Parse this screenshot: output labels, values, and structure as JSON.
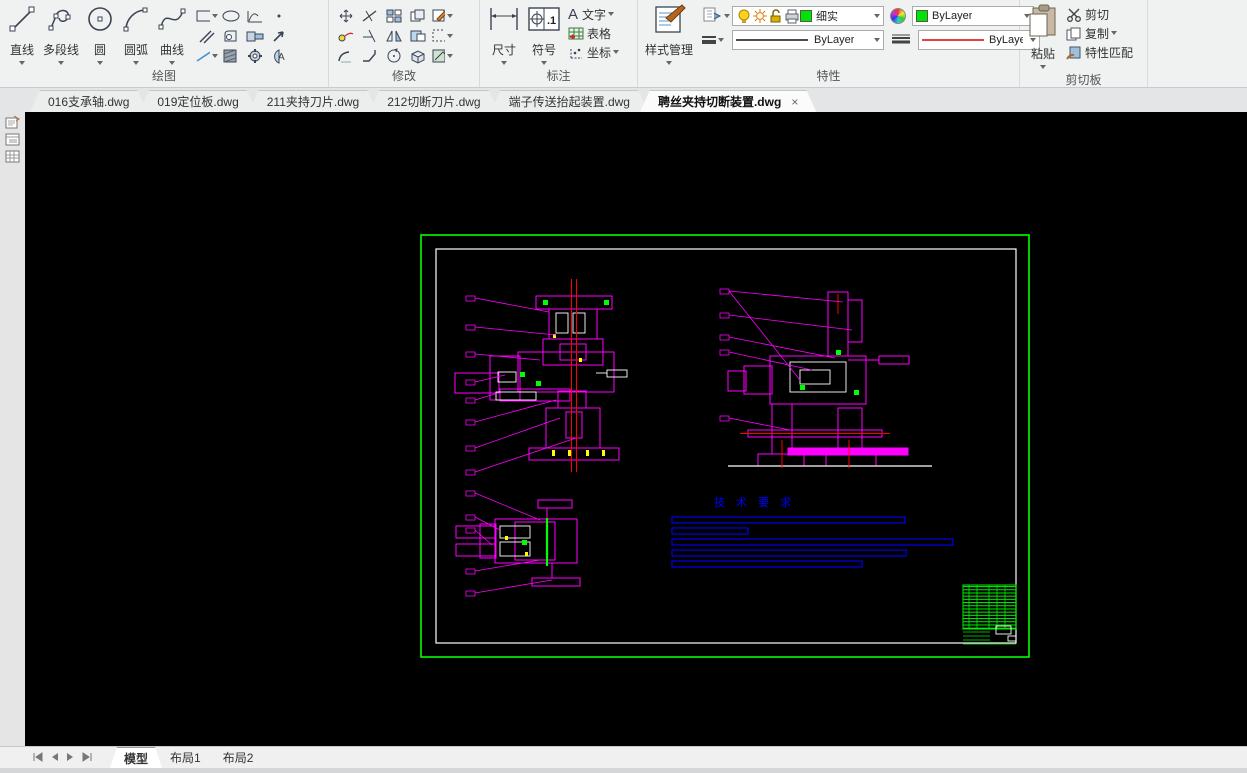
{
  "ribbon": {
    "panels": {
      "draw": {
        "label": "绘图",
        "buttons": [
          {
            "label": "直线"
          },
          {
            "label": "多段线"
          },
          {
            "label": "圆"
          },
          {
            "label": "圆弧"
          },
          {
            "label": "曲线"
          }
        ]
      },
      "modify": {
        "label": "修改"
      },
      "annotate": {
        "label": "标注",
        "dim": "尺寸",
        "symbol": "符号",
        "symbol_icon_text": ".1",
        "text": "文字",
        "text_icon": "A",
        "table": "表格",
        "coord": "坐标"
      },
      "properties": {
        "label": "特性",
        "style_manager": "样式管理",
        "layer_value": "细实",
        "color_value": "ByLayer",
        "linetype_value": "ByLayer",
        "lineweight_value": "ByLayer"
      },
      "clipboard": {
        "label": "剪切板",
        "paste": "粘贴",
        "cut": "剪切",
        "copy": "复制",
        "match": "特性匹配"
      }
    }
  },
  "file_tabs": {
    "close_glyph": "×",
    "tabs": [
      {
        "label": "016支承轴.dwg",
        "active": false
      },
      {
        "label": "019定位板.dwg",
        "active": false
      },
      {
        "label": "211夹持刀片.dwg",
        "active": false
      },
      {
        "label": "212切断刀片.dwg",
        "active": false
      },
      {
        "label": "端子传送抬起装置.dwg",
        "active": false
      },
      {
        "label": "聘丝夹持切断装置.dwg",
        "active": true
      }
    ]
  },
  "drawing": {
    "tech_requirements_title": "技 术 要 求",
    "colors": {
      "background": "#000000",
      "frame": "#00ff00",
      "paper_border": "#ffffff",
      "outline": "#ff00ff",
      "centerline": "#ff0000",
      "accent": "#00ff00",
      "annotation_text": "#0000ff",
      "highlight": "#ffff00"
    }
  },
  "layout_tabs": {
    "model": "模型",
    "layout1": "布局1",
    "layout2": "布局2"
  }
}
